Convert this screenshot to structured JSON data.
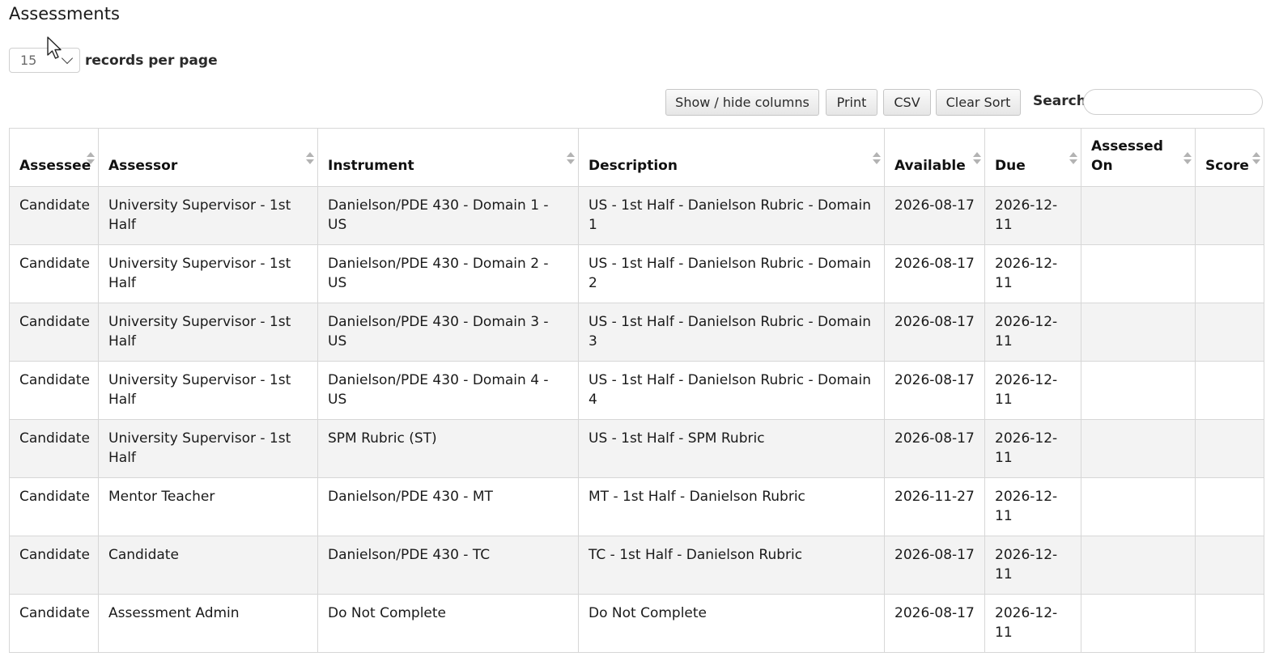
{
  "page": {
    "title": "Assessments"
  },
  "length": {
    "value": "15",
    "label": "records per page"
  },
  "toolbar": {
    "show_hide": "Show / hide columns",
    "print": "Print",
    "csv": "CSV",
    "clear_sort": "Clear Sort",
    "search_label": "Search:",
    "search_value": ""
  },
  "table": {
    "headers": [
      "Assessee",
      "Assessor",
      "Instrument",
      "Description",
      "Available",
      "Due",
      "Assessed On",
      "Score"
    ],
    "rows": [
      [
        "Candidate",
        "University Supervisor - 1st Half",
        "Danielson/PDE 430 - Domain 1 - US",
        "US - 1st Half - Danielson Rubric - Domain 1",
        "2026-08-17",
        "2026-12-11",
        "",
        ""
      ],
      [
        "Candidate",
        "University Supervisor - 1st Half",
        "Danielson/PDE 430 - Domain 2 - US",
        "US - 1st Half - Danielson Rubric - Domain 2",
        "2026-08-17",
        "2026-12-11",
        "",
        ""
      ],
      [
        "Candidate",
        "University Supervisor - 1st Half",
        "Danielson/PDE 430 - Domain 3 - US",
        "US - 1st Half - Danielson Rubric - Domain 3",
        "2026-08-17",
        "2026-12-11",
        "",
        ""
      ],
      [
        "Candidate",
        "University Supervisor - 1st Half",
        "Danielson/PDE 430 - Domain 4 - US",
        "US - 1st Half - Danielson Rubric - Domain 4",
        "2026-08-17",
        "2026-12-11",
        "",
        ""
      ],
      [
        "Candidate",
        "University Supervisor - 1st Half",
        "SPM Rubric (ST)",
        "US - 1st Half - SPM Rubric",
        "2026-08-17",
        "2026-12-11",
        "",
        ""
      ],
      [
        "Candidate",
        "Mentor Teacher",
        "Danielson/PDE 430 - MT",
        "MT - 1st Half - Danielson Rubric",
        "2026-11-27",
        "2026-12-11",
        "",
        ""
      ],
      [
        "Candidate",
        "Candidate",
        "Danielson/PDE 430 - TC",
        "TC - 1st Half - Danielson Rubric",
        "2026-08-17",
        "2026-12-11",
        "",
        ""
      ],
      [
        "Candidate",
        "Assessment Admin",
        "Do Not Complete",
        "Do Not Complete",
        "2026-08-17",
        "2026-12-11",
        "",
        ""
      ]
    ]
  }
}
